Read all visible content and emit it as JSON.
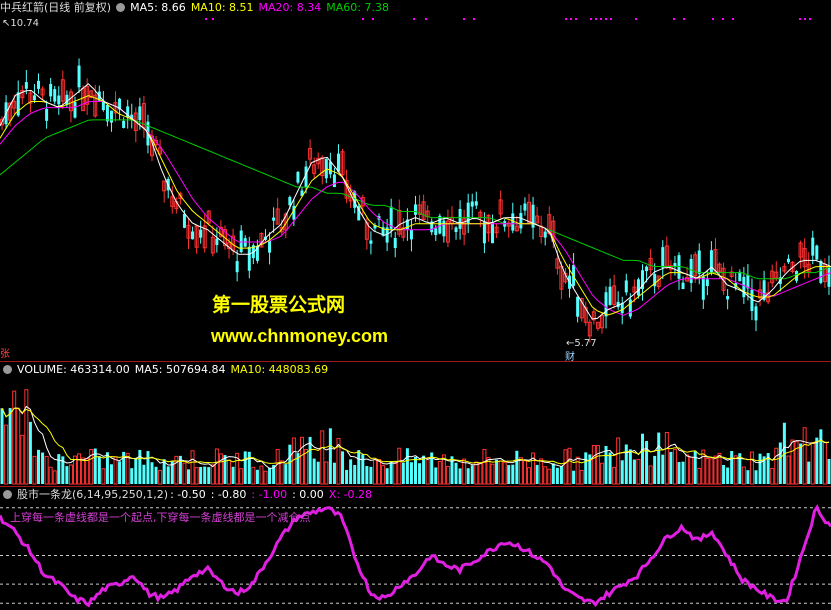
{
  "price": {
    "title": "中兵红箭(日线 前复权)",
    "ma5_label": "MA5: 8.66",
    "ma10_label": "MA10: 8.51",
    "ma20_label": "MA20: 8.34",
    "ma60_label": "MA60: 7.38",
    "high_label": "10.74",
    "low_label": "5.77",
    "cai_label": "财",
    "zhang_label": "张",
    "watermark1": "第一股票公式网",
    "watermark2": "www.chnmoney.com"
  },
  "volume": {
    "label": "VOLUME: 463314.00",
    "ma5_label": "MA5: 507694.84",
    "ma10_label": "MA10: 448083.69"
  },
  "indicator": {
    "title": "股市一条龙(6,14,95,250,1,2)",
    "v1": ": -0.50",
    "v2": ": -0.80",
    "v3": ": -1.00",
    "v4": ": 0.00",
    "v5": "X: -0.28",
    "note": "上穿每一条虚线都是一个起点,下穿每一条虚线都是一个减仓点"
  },
  "colors": {
    "up": "#ff3232",
    "down": "#54ffff",
    "ma5": "#ffffff",
    "ma10": "#ffff00",
    "ma20": "#ff00ff",
    "ma60": "#00cc00",
    "indicator_line": "#e020e0",
    "separator": "#a0181b",
    "watermark": "#ffff00"
  },
  "chart_data": {
    "type": "candlestick",
    "price_range": [
      5.5,
      11.0
    ],
    "high": 10.74,
    "low": 5.77,
    "ma5_path": [
      9.2,
      9.7,
      9.8,
      9.6,
      9.5,
      9.7,
      9.9,
      9.6,
      9.5,
      9.3,
      9.1,
      8.4,
      7.9,
      7.6,
      7.5,
      7.3,
      7.1,
      7.1,
      7.4,
      7.6,
      8.1,
      8.6,
      8.7,
      8.4,
      7.9,
      7.5,
      7.4,
      7.6,
      7.7,
      7.6,
      7.7,
      7.6,
      7.7,
      7.6,
      7.7,
      7.7,
      7.6,
      7.5,
      6.8,
      6.4,
      6.0,
      6.2,
      6.3,
      6.5,
      6.8,
      6.9,
      6.8,
      6.7,
      6.9,
      6.6,
      6.5,
      6.3,
      6.5,
      6.8,
      7.0,
      7.0,
      6.9
    ],
    "ma10_path": [
      9.0,
      9.4,
      9.6,
      9.6,
      9.5,
      9.6,
      9.7,
      9.6,
      9.4,
      9.3,
      9.1,
      8.6,
      8.1,
      7.8,
      7.6,
      7.4,
      7.2,
      7.2,
      7.3,
      7.5,
      7.9,
      8.3,
      8.5,
      8.4,
      8.0,
      7.6,
      7.5,
      7.5,
      7.6,
      7.6,
      7.6,
      7.6,
      7.6,
      7.6,
      7.7,
      7.6,
      7.6,
      7.5,
      7.0,
      6.6,
      6.2,
      6.1,
      6.2,
      6.4,
      6.6,
      6.8,
      6.8,
      6.7,
      6.8,
      6.7,
      6.5,
      6.4,
      6.4,
      6.6,
      6.8,
      6.9,
      6.9
    ],
    "ma20_path": [
      8.9,
      9.2,
      9.4,
      9.5,
      9.5,
      9.5,
      9.6,
      9.6,
      9.5,
      9.3,
      9.1,
      8.8,
      8.4,
      8.0,
      7.7,
      7.5,
      7.3,
      7.3,
      7.3,
      7.4,
      7.7,
      8.0,
      8.2,
      8.3,
      8.1,
      7.8,
      7.6,
      7.5,
      7.5,
      7.5,
      7.6,
      7.6,
      7.6,
      7.6,
      7.6,
      7.6,
      7.6,
      7.5,
      7.2,
      6.8,
      6.4,
      6.2,
      6.1,
      6.2,
      6.4,
      6.6,
      6.7,
      6.7,
      6.7,
      6.7,
      6.6,
      6.5,
      6.4,
      6.5,
      6.6,
      6.7,
      6.8
    ],
    "ma60_path": [
      8.4,
      8.6,
      8.8,
      9.0,
      9.1,
      9.2,
      9.3,
      9.3,
      9.3,
      9.3,
      9.2,
      9.1,
      9.0,
      8.9,
      8.8,
      8.7,
      8.6,
      8.5,
      8.4,
      8.3,
      8.2,
      8.2,
      8.1,
      8.1,
      8.0,
      7.9,
      7.9,
      7.8,
      7.8,
      7.7,
      7.7,
      7.7,
      7.7,
      7.7,
      7.6,
      7.6,
      7.6,
      7.5,
      7.4,
      7.3,
      7.2,
      7.1,
      7.0,
      7.0,
      6.9,
      6.9,
      6.9,
      6.8,
      6.8,
      6.8,
      6.8,
      6.7,
      6.7,
      6.7,
      6.8,
      6.8,
      6.9
    ],
    "indicator_levels": [
      -1.0,
      -0.8,
      -0.5,
      0.0
    ],
    "indicator_range": [
      -1.05,
      0.05
    ],
    "indicator_path": [
      -0.1,
      -0.25,
      -0.45,
      -0.7,
      -0.8,
      -0.95,
      -1.0,
      -0.85,
      -0.8,
      -0.7,
      -0.9,
      -0.95,
      -0.85,
      -0.7,
      -0.65,
      -0.8,
      -0.9,
      -0.8,
      -0.55,
      -0.3,
      -0.1,
      -0.05,
      0.0,
      -0.1,
      -0.55,
      -0.9,
      -0.95,
      -0.8,
      -0.7,
      -0.5,
      -0.6,
      -0.65,
      -0.55,
      -0.45,
      -0.35,
      -0.4,
      -0.5,
      -0.6,
      -0.85,
      -0.95,
      -1.0,
      -0.9,
      -0.8,
      -0.7,
      -0.5,
      -0.3,
      -0.2,
      -0.35,
      -0.25,
      -0.5,
      -0.75,
      -0.85,
      -0.95,
      -0.98,
      -0.5,
      0.0,
      -0.2
    ]
  }
}
